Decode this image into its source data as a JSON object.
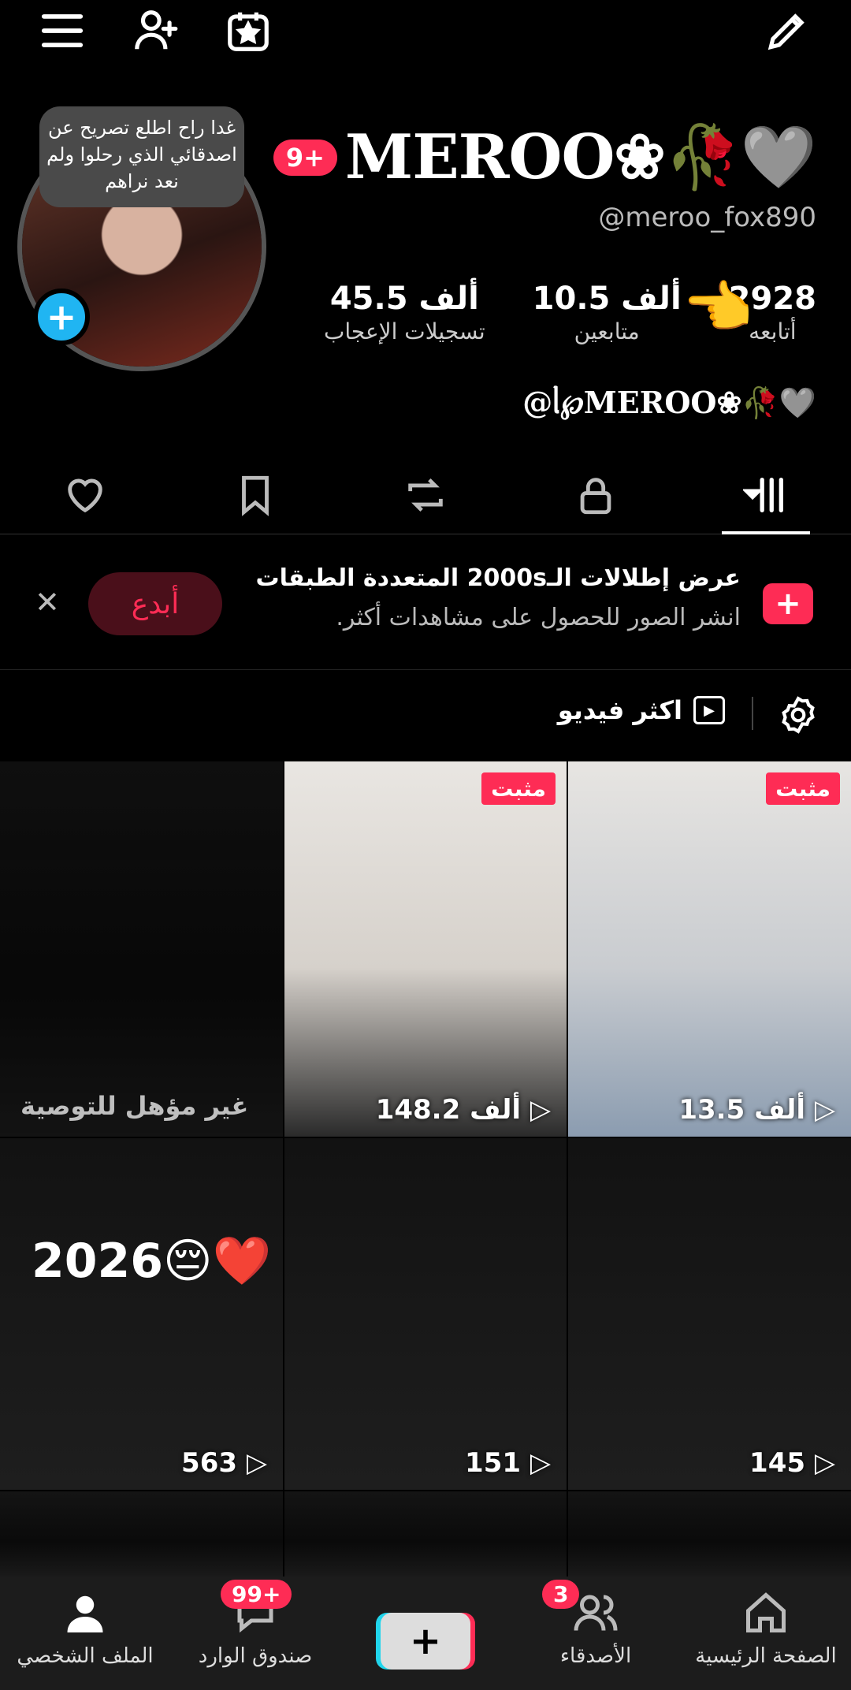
{
  "header": {
    "display_name": "MEROO❀🥀🩶",
    "notification_badge": "9+",
    "username": "@meroo_fox890",
    "note": "غدا راح اطلع تصريح عن اصدقائي الذي رحلوا ولم نعد نراهم"
  },
  "stats": [
    {
      "value": "2928",
      "label": "أتابعه"
    },
    {
      "value": "10.5 ألف",
      "label": "متابعين"
    },
    {
      "value": "45.5 ألف",
      "label": "تسجيلات الإعجاب"
    }
  ],
  "bio": "@ᥣ℘MEROO❀🥀🩶",
  "promo": {
    "title": "عرض إطلالات الـ2000s المتعددة الطبقات",
    "subtitle": "انشر الصور للحصول على مشاهدات أكثر.",
    "create_label": "أبدع"
  },
  "filter": {
    "label": "اكثر فيديو"
  },
  "grid": {
    "pinned_label": "مثبت",
    "not_eligible": "غير مؤهل للتوصية",
    "year_overlay": "2026😔❤️",
    "videos": [
      {
        "views": "13.5 ألف"
      },
      {
        "views": "148.2 ألف"
      },
      {
        "views": "145"
      },
      {
        "views": "151"
      },
      {
        "views": "563"
      }
    ]
  },
  "nav": {
    "home": "الصفحة الرئيسية",
    "friends": "الأصدقاء",
    "friends_badge": "3",
    "inbox": "صندوق الوارد",
    "inbox_badge": "99+",
    "profile": "الملف الشخصي"
  },
  "colors": {
    "accent": "#fe2c55",
    "story_add": "#20b5f2"
  }
}
